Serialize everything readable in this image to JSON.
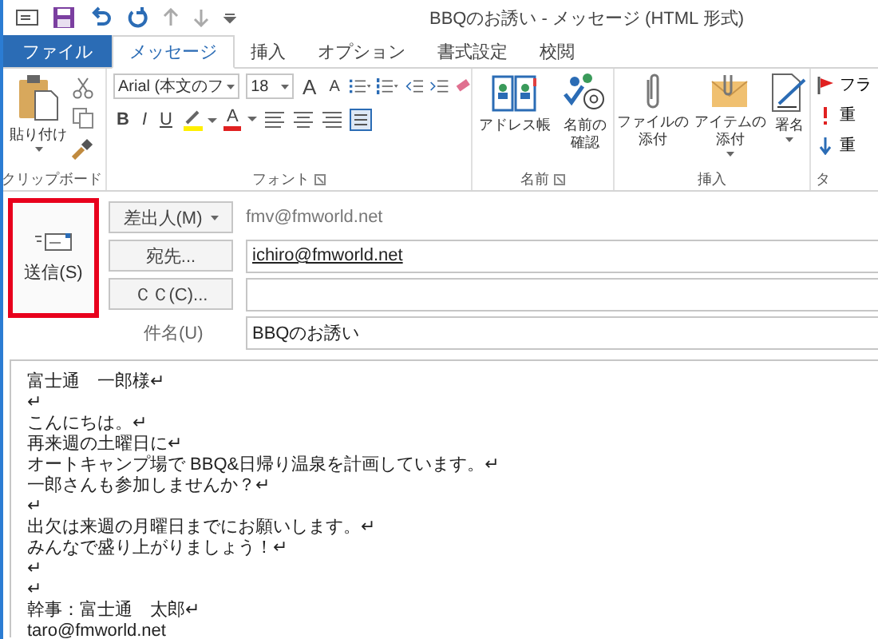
{
  "window": {
    "title": "BBQのお誘い - メッセージ (HTML 形式)"
  },
  "tabs": [
    {
      "label": "ファイル",
      "kind": "file",
      "selected": false
    },
    {
      "label": "メッセージ",
      "kind": "tab",
      "selected": true
    },
    {
      "label": "挿入",
      "kind": "tab",
      "selected": false
    },
    {
      "label": "オプション",
      "kind": "tab",
      "selected": false
    },
    {
      "label": "書式設定",
      "kind": "tab",
      "selected": false
    },
    {
      "label": "校閲",
      "kind": "tab",
      "selected": false
    }
  ],
  "ribbon": {
    "groups": [
      {
        "kind": "clipboard",
        "label": "クリップボード",
        "paste": "貼り付け"
      },
      {
        "kind": "font",
        "label": "フォント",
        "font_name": "Arial (本文のフ",
        "font_size": "18",
        "grow": "A",
        "shrink": "A",
        "bold": "B",
        "italic": "I",
        "underline": "U",
        "font_color": "A"
      },
      {
        "kind": "names",
        "label": "名前",
        "buttons": [
          {
            "lines": [
              "アドレス帳"
            ],
            "dropdown": false
          },
          {
            "lines": [
              "名前の",
              "確認"
            ],
            "dropdown": false
          }
        ]
      },
      {
        "kind": "include",
        "label": "挿入",
        "buttons": [
          {
            "lines": [
              "ファイルの",
              "添付"
            ],
            "dropdown": false
          },
          {
            "lines": [
              "アイテムの",
              "添付"
            ],
            "dropdown": true
          },
          {
            "lines": [
              "署名"
            ],
            "dropdown": true
          }
        ]
      },
      {
        "kind": "tags",
        "label": "タ",
        "items": [
          "フラ",
          "重",
          "重"
        ]
      }
    ]
  },
  "compose": {
    "send": {
      "label": "送信(S)",
      "highlighted": true
    },
    "from": {
      "button": "差出人(M)",
      "value": "fmv@fmworld.net"
    },
    "to": {
      "button": "宛先...",
      "value": "ichiro@fmworld.net"
    },
    "cc": {
      "button": "ＣＣ(C)..."
    },
    "subject": {
      "label": "件名(U)",
      "value": "BBQのお誘い"
    }
  },
  "body": {
    "lines": [
      "富士通　一郎様↵",
      "↵",
      "こんにちは。↵",
      "再来週の土曜日に↵",
      "オートキャンプ場で BBQ&日帰り温泉を計画しています。↵",
      "一郎さんも参加しませんか？↵",
      "↵",
      "出欠は来週の月曜日までにお願いします。↵",
      "みんなで盛り上がりましょう！↵",
      "↵",
      "↵",
      "幹事：富士通　太郎↵",
      "taro@fmworld.net"
    ]
  }
}
